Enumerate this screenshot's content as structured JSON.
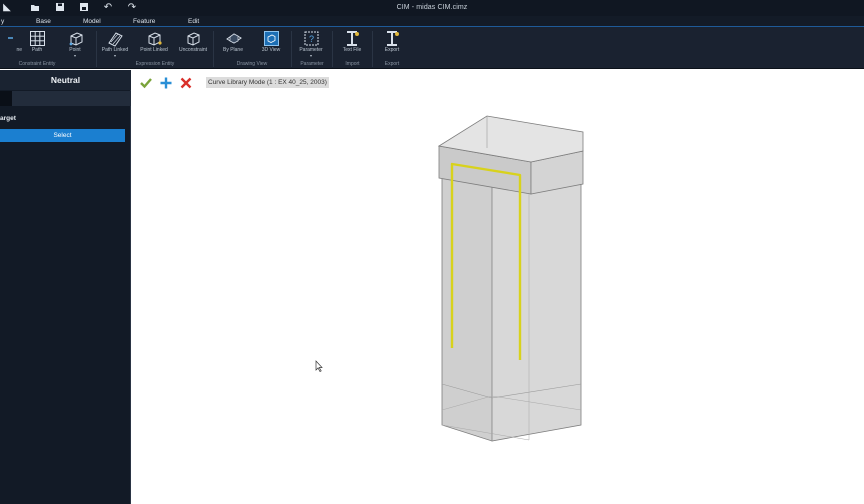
{
  "window": {
    "title": "CIM - midas CIM.cimz"
  },
  "quick_access": [
    {
      "name": "app-icon",
      "glyph": "◣"
    },
    {
      "name": "open-icon",
      "glyph": "📂"
    },
    {
      "name": "save-icon",
      "glyph": "💾"
    },
    {
      "name": "save-as-icon",
      "glyph": "▣"
    },
    {
      "name": "undo-icon",
      "glyph": "↶"
    },
    {
      "name": "redo-icon",
      "glyph": "↷"
    }
  ],
  "menu": {
    "items": [
      "y",
      "Base",
      "Model",
      "Feature",
      "Edit"
    ]
  },
  "ribbon": {
    "buttons": [
      {
        "label": "ne",
        "icon": "line-icon"
      },
      {
        "label": "Path",
        "icon": "grid-path-icon"
      },
      {
        "label": "Point",
        "icon": "cube-point-icon",
        "dropdown": "▾"
      },
      {
        "label": "Path Linked",
        "icon": "path-linked-icon",
        "dropdown": "▾"
      },
      {
        "label": "Point Linked",
        "icon": "point-linked-icon"
      },
      {
        "label": "Unconstraint",
        "icon": "unconstraint-icon"
      },
      {
        "label": "By Plane",
        "icon": "by-plane-icon"
      },
      {
        "label": "3D View",
        "icon": "3d-view-icon"
      },
      {
        "label": "Parameter",
        "icon": "parameter-icon",
        "dropdown": "▾"
      },
      {
        "label": "Text File",
        "icon": "text-file-icon"
      },
      {
        "label": "Export",
        "icon": "export-icon"
      }
    ],
    "groups": [
      "Constraint Entity",
      "Expression Entity",
      "Drawing View",
      "Parameter",
      "Import",
      "Export"
    ]
  },
  "panel": {
    "header": "Neutral",
    "target_label": "arget",
    "select_button": "Select"
  },
  "viewport": {
    "mode_label": "Curve Library Mode (1 : EX 40_25, 2003)",
    "actions": [
      {
        "name": "confirm-check-icon",
        "color": "#7aa33a"
      },
      {
        "name": "add-plus-icon",
        "color": "#2a8fd6"
      },
      {
        "name": "cancel-x-icon",
        "color": "#d9302a"
      }
    ]
  },
  "colors": {
    "titlebar": "#101722",
    "ribbon": "#1a2230",
    "panel": "#121a26",
    "accent_blue": "#1b7fd0",
    "rebar_yellow": "#d8d21c"
  }
}
